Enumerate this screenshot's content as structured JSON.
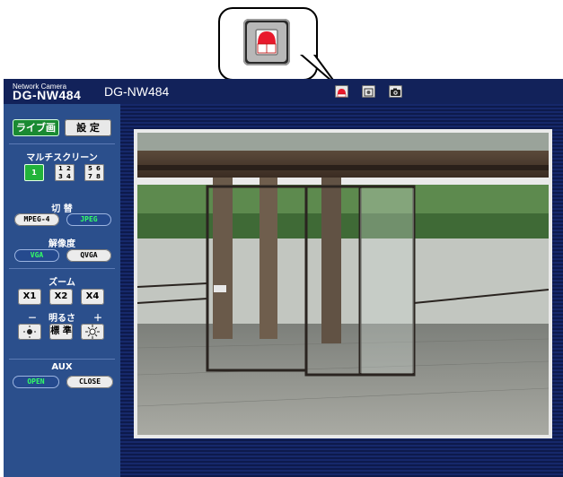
{
  "header": {
    "brand_small": "Network Camera",
    "brand_model": "DG-NW484",
    "camera_title": "DG-NW484",
    "toolbar_icons": [
      "alarm-icon",
      "snapshot-frame-icon",
      "camera-icon"
    ]
  },
  "callout": {
    "icon": "alarm-icon"
  },
  "tabs": {
    "live": "ライブ画",
    "setup": "設 定"
  },
  "multiscreen": {
    "label": "マルチスクリーン",
    "single": "1",
    "quad_a": [
      "1",
      "2",
      "3",
      "4"
    ],
    "quad_b": [
      "5",
      "6",
      "7",
      "8"
    ]
  },
  "codec": {
    "label": "切 替",
    "mpeg4": "MPEG-4",
    "jpeg": "JPEG",
    "selected": "JPEG"
  },
  "resolution": {
    "label": "解像度",
    "vga": "VGA",
    "qvga": "QVGA",
    "selected": "VGA"
  },
  "zoom": {
    "label": "ズーム",
    "x1": "X1",
    "x2": "X2",
    "x4": "X4"
  },
  "brightness": {
    "minus": "－",
    "label": "明るさ",
    "plus": "＋",
    "standard": "標 準"
  },
  "aux": {
    "label": "AUX",
    "open": "OPEN",
    "close": "CLOSE",
    "selected": "OPEN"
  },
  "colors": {
    "page_bg": "#12225a",
    "sidebar_bg": "#2b4f8c",
    "live_tab": "#1a8a32",
    "selected_text": "#33ff66"
  }
}
